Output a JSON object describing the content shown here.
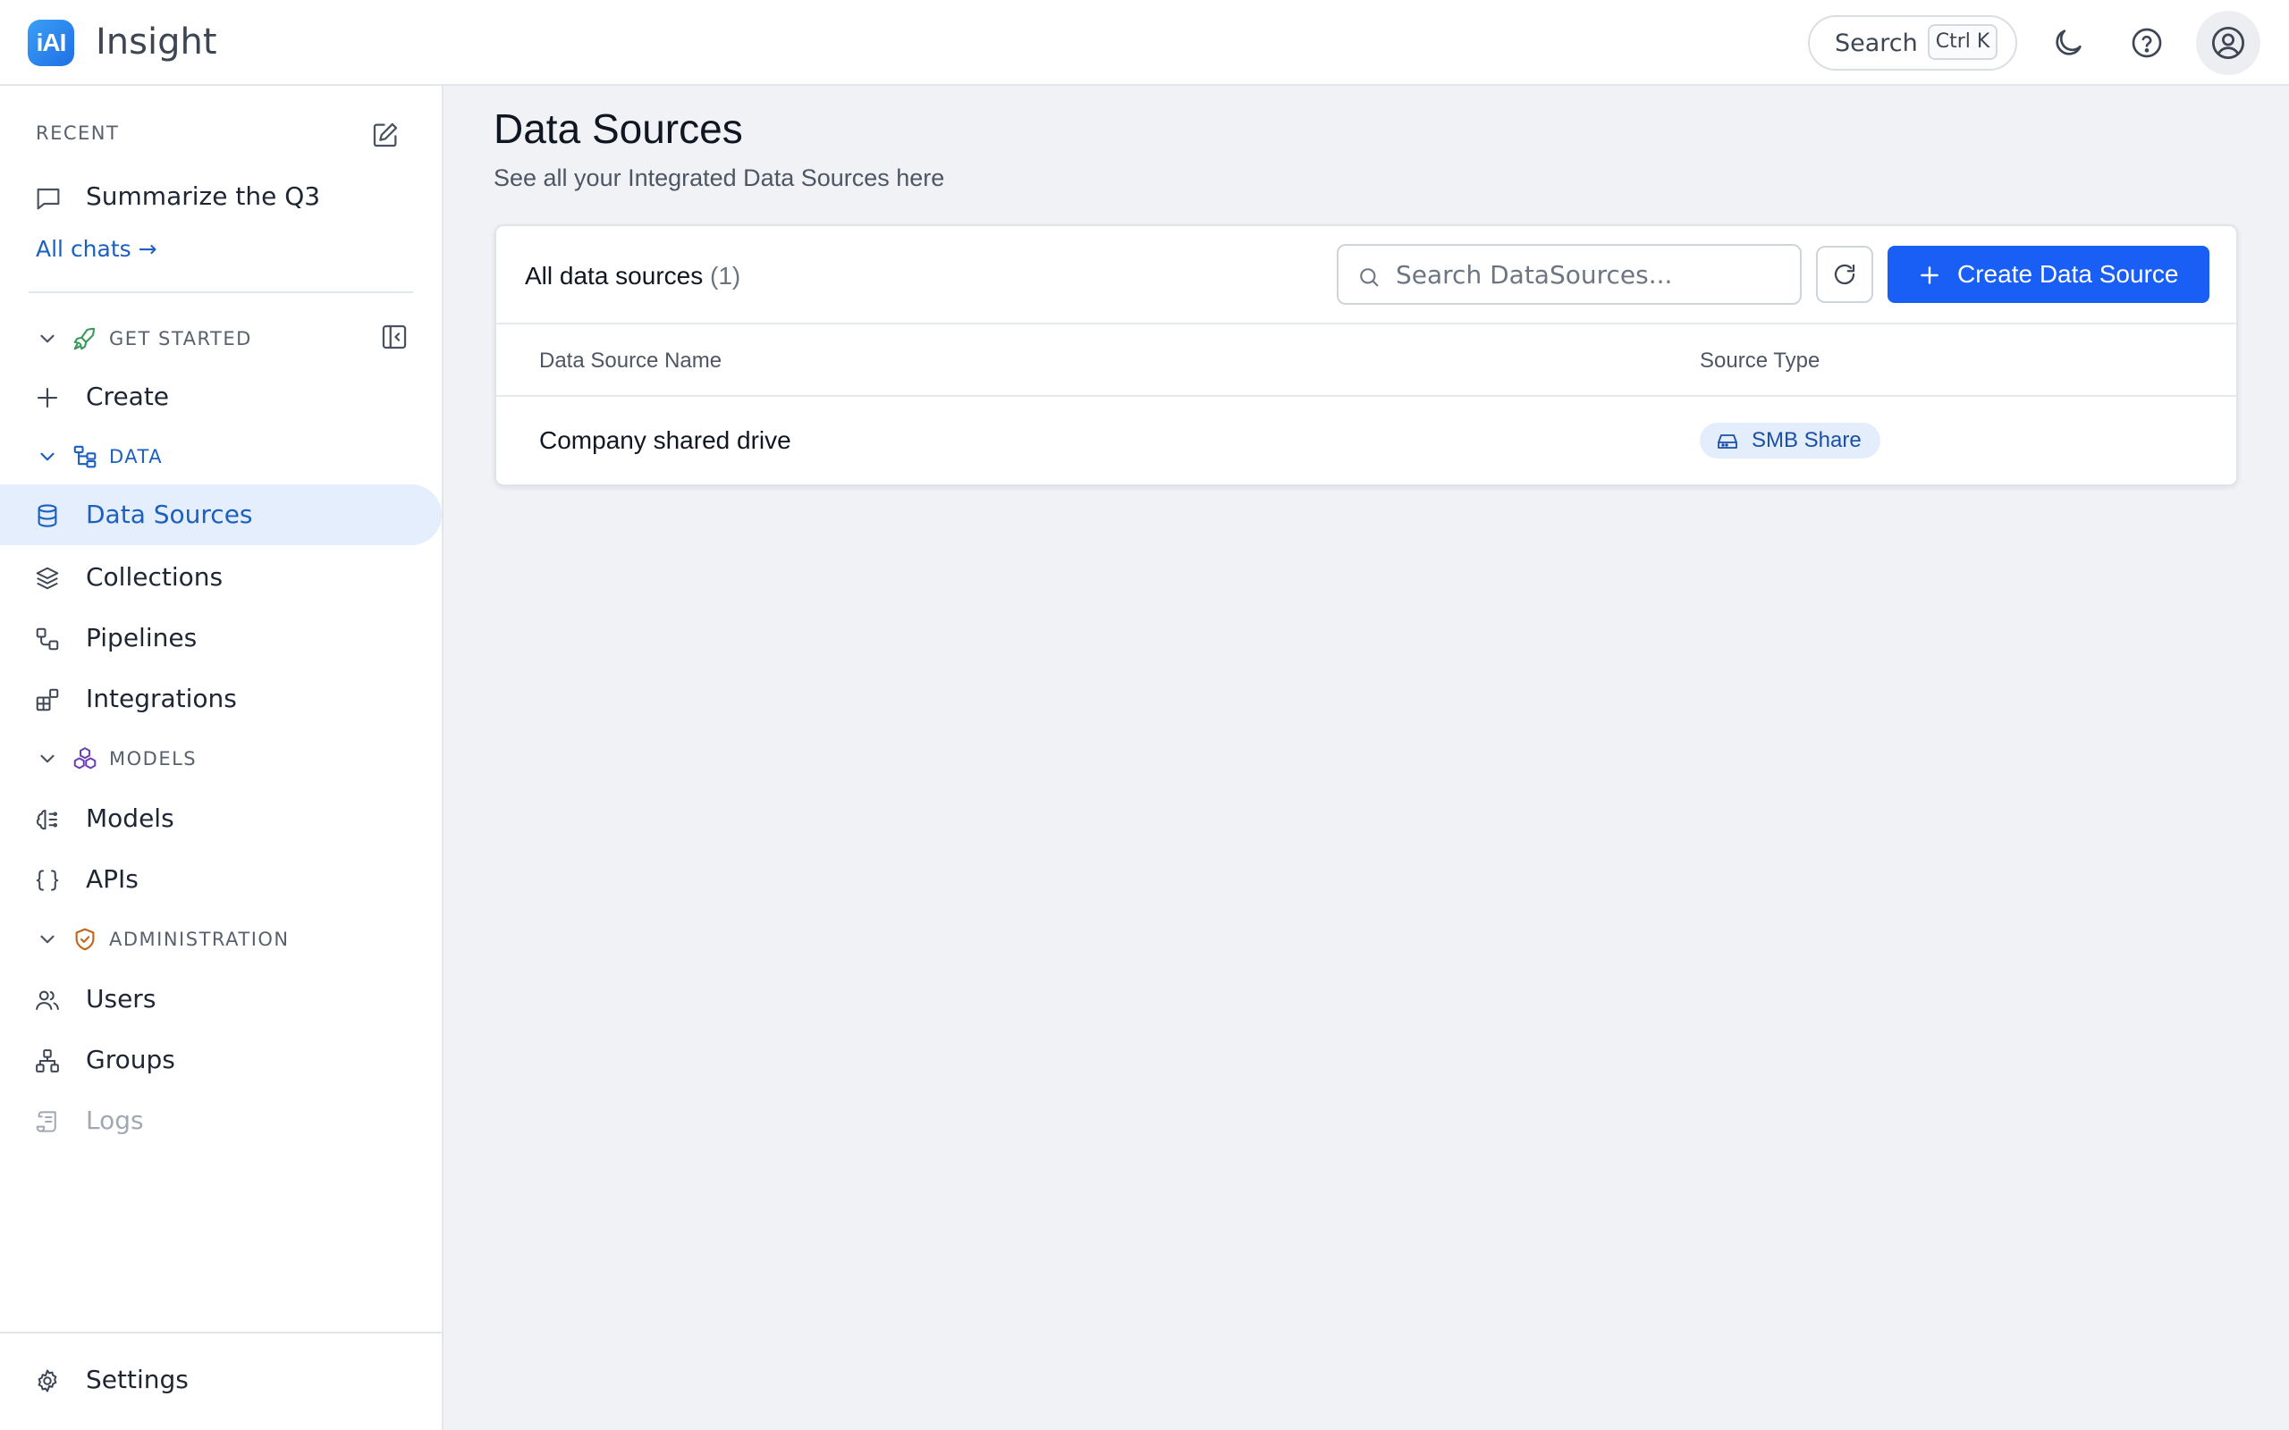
{
  "app": {
    "logo_text": "iAI",
    "name": "Insight"
  },
  "topbar": {
    "search_label": "Search",
    "search_shortcut": "Ctrl K"
  },
  "sidebar": {
    "recent_label": "RECENT",
    "recent_chats": [
      "Summarize the Q3"
    ],
    "all_chats_label": "All chats →",
    "sections": {
      "get_started": "GET STARTED",
      "data": "DATA",
      "models": "MODELS",
      "administration": "ADMINISTRATION"
    },
    "items": {
      "create": "Create",
      "data_sources": "Data Sources",
      "collections": "Collections",
      "pipelines": "Pipelines",
      "integrations": "Integrations",
      "models": "Models",
      "apis": "APIs",
      "users": "Users",
      "groups": "Groups",
      "logs": "Logs",
      "settings": "Settings"
    }
  },
  "main": {
    "title": "Data Sources",
    "subtitle": "See all your Integrated Data Sources here",
    "card": {
      "title": "All data sources",
      "count": "(1)",
      "search_placeholder": "Search DataSources...",
      "create_label": "Create Data Source",
      "columns": [
        "Data Source Name",
        "Source Type"
      ],
      "rows": [
        {
          "name": "Company shared drive",
          "type": "SMB Share"
        }
      ]
    }
  },
  "colors": {
    "accent": "#1a5ff5",
    "active_bg": "#e4eefc",
    "active_text": "#1b5fbf",
    "badge_bg": "#e3edfb"
  }
}
